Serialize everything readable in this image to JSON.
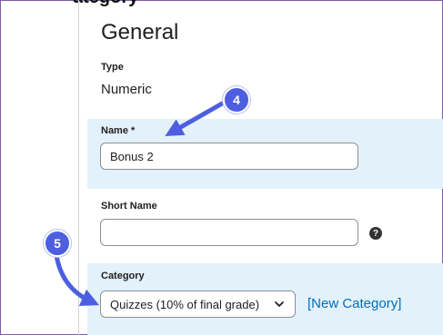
{
  "header": {
    "cut_heading": "ategory"
  },
  "section": {
    "title": "General"
  },
  "type_field": {
    "label": "Type",
    "value": "Numeric"
  },
  "name_field": {
    "label": "Name *",
    "value": "Bonus 2"
  },
  "short_name_field": {
    "label": "Short Name",
    "value": "",
    "help_glyph": "?"
  },
  "category_field": {
    "label": "Category",
    "selected": "Quizzes (10% of final grade)",
    "new_category_link": "[New Category]"
  },
  "callouts": [
    {
      "number": "4"
    },
    {
      "number": "5"
    }
  ],
  "colors": {
    "band": "#e3f1fa",
    "callout": "#4d5fe0",
    "link": "#006fbf",
    "frame": "#7b5ea7"
  },
  "icons": {
    "help": "question-circle-icon",
    "dropdown": "chevron-down-icon"
  }
}
